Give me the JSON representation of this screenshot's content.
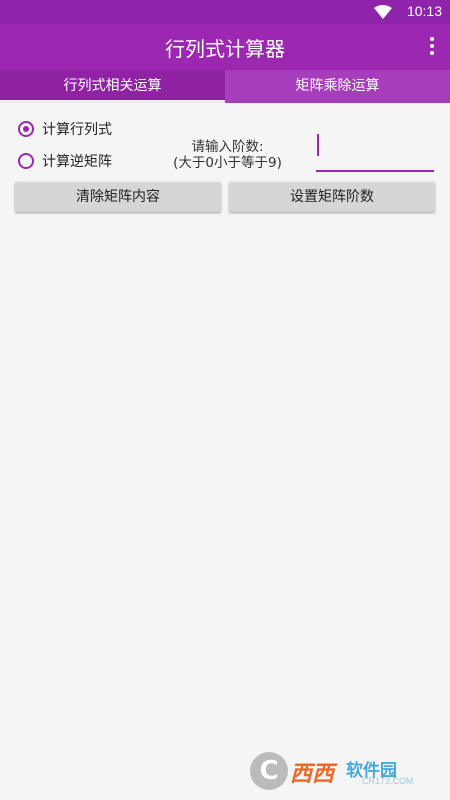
{
  "status_bar": {
    "time": "10:13",
    "wifi_icon": "wifi-icon"
  },
  "app_bar": {
    "title": "行列式计算器",
    "overflow_icon": "more-vert-icon"
  },
  "tabs": [
    {
      "label": "行列式相关运算",
      "selected": true
    },
    {
      "label": "矩阵乘除运算",
      "selected": false
    }
  ],
  "radios": [
    {
      "label": "计算行列式",
      "checked": true
    },
    {
      "label": "计算逆矩阵",
      "checked": false
    }
  ],
  "order_input": {
    "prompt_line1": "请输入阶数:",
    "prompt_line2": "(大于0小于等于9)",
    "value": ""
  },
  "buttons": {
    "clear_label": "清除矩阵内容",
    "set_order_label": "设置矩阵阶数"
  },
  "watermark": {
    "brand": "西西",
    "site": "软件园",
    "domain": "CR173.COM"
  },
  "colors": {
    "primary": "#9c27b0",
    "primary_dark": "#8e24aa",
    "background": "#f5f5f5"
  }
}
